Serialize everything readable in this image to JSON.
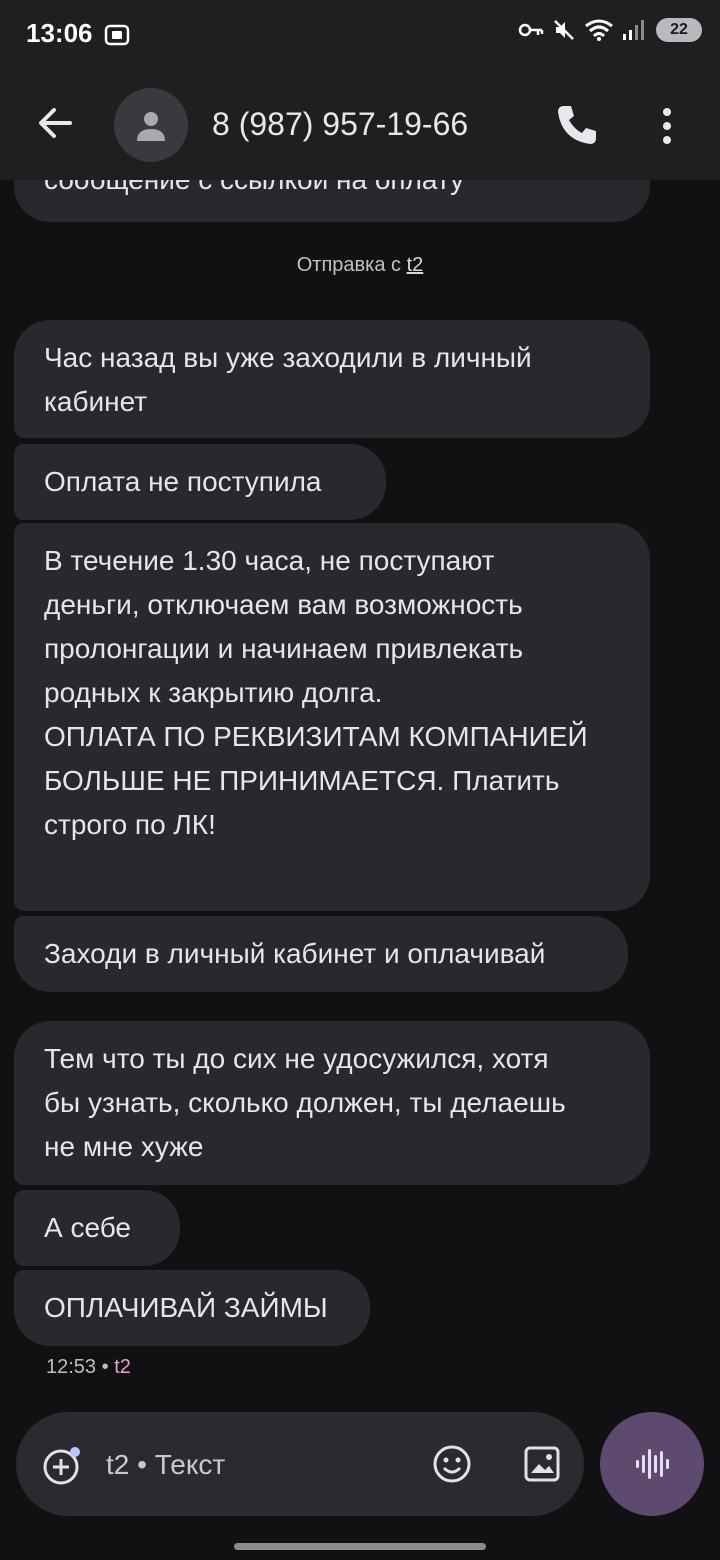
{
  "status_bar": {
    "time": "13:06",
    "battery": "22"
  },
  "header": {
    "contact": "8 (987) 957-19-66",
    "icons": [
      "back-arrow-icon",
      "avatar-person-icon",
      "phone-icon",
      "more-vert-icon"
    ]
  },
  "conversation": {
    "cut_message": "сообщение с ссылкой на оплату",
    "sent_via_prefix": "Отправка с ",
    "sent_via_link": "t2",
    "messages": [
      {
        "text": "Час назад вы уже заходили в личный\nкабинет"
      },
      {
        "text": "Оплата не поступила"
      },
      {
        "text": "В течение 1.30 часа, не поступают\nденьги, отключаем вам возможность\nпролонгации и начинаем привлекать\nродных к закрытию долга.\nОПЛАТА ПО РЕКВИЗИТАМ КОМПАНИЕЙ\nБОЛЬШЕ НЕ ПРИНИМАЕТСЯ. Платить\nстрого по ЛК!\n"
      },
      {
        "text": "Заходи в личный кабинет и оплачивай"
      },
      {
        "text": "Тем что ты до сих не удосужился, хотя\nбы узнать, сколько должен, ты делаешь\nне мне хуже"
      },
      {
        "text": "А себе"
      },
      {
        "text": "ОПЛАЧИВАЙ ЗАЙМЫ"
      }
    ],
    "last_time": "12:53",
    "last_sim": "t2"
  },
  "composer": {
    "placeholder": "t2 • Текст",
    "icons": [
      "add-circle-icon",
      "emoji-icon",
      "gallery-icon",
      "voice-wave-icon"
    ]
  },
  "colors": {
    "bubble": "#28282d",
    "background": "#111114",
    "voice_button": "#5e4a6e",
    "sim_label": "#e8a0d4"
  }
}
